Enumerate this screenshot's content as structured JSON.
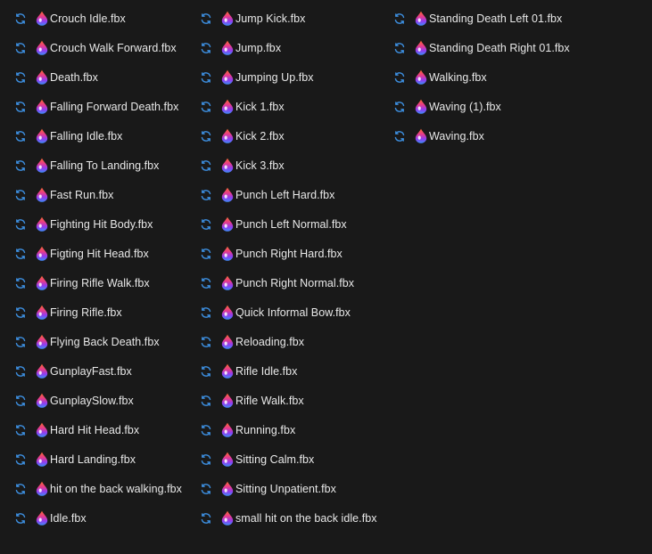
{
  "icons": {
    "status_icon": "sync-icon",
    "file_icon": "fbx-app-icon",
    "sync_color": "#3d8fe0",
    "file_icon_colors": [
      "#fb6b2e",
      "#e63b8c",
      "#8f3df2",
      "#3b8ef5"
    ]
  },
  "columns": [
    {
      "files": [
        "Crouch Idle.fbx",
        "Crouch Walk Forward.fbx",
        "Death.fbx",
        "Falling Forward Death.fbx",
        "Falling Idle.fbx",
        "Falling To Landing.fbx",
        "Fast Run.fbx",
        "Fighting Hit Body.fbx",
        "Figting Hit Head.fbx",
        "Firing Rifle Walk.fbx",
        "Firing Rifle.fbx",
        "Flying Back Death.fbx",
        "GunplayFast.fbx",
        "GunplaySlow.fbx",
        "Hard Hit Head.fbx",
        "Hard Landing.fbx",
        "hit on the back walking.fbx",
        "Idle.fbx"
      ]
    },
    {
      "files": [
        "Jump Kick.fbx",
        "Jump.fbx",
        "Jumping Up.fbx",
        "Kick 1.fbx",
        "Kick 2.fbx",
        "Kick 3.fbx",
        "Punch Left Hard.fbx",
        "Punch Left Normal.fbx",
        "Punch Right Hard.fbx",
        "Punch Right Normal.fbx",
        "Quick Informal Bow.fbx",
        "Reloading.fbx",
        "Rifle Idle.fbx",
        "Rifle Walk.fbx",
        "Running.fbx",
        "Sitting Calm.fbx",
        "Sitting Unpatient.fbx",
        "small hit on the back idle.fbx"
      ]
    },
    {
      "files": [
        "Standing Death Left 01.fbx",
        "Standing Death Right 01.fbx",
        "Walking.fbx",
        "Waving (1).fbx",
        "Waving.fbx"
      ]
    }
  ]
}
